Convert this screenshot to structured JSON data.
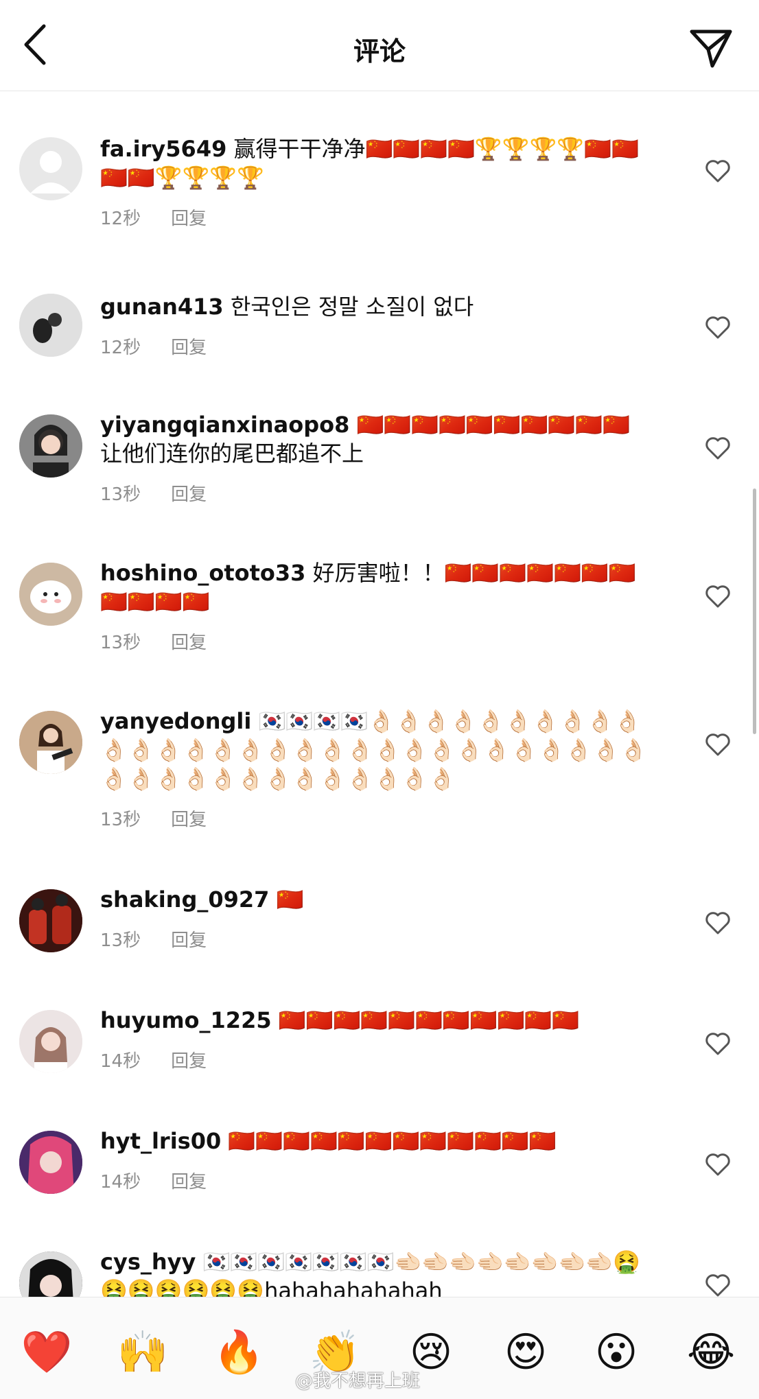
{
  "header": {
    "title": "评论"
  },
  "comments": [
    {
      "user": "fa.iry5649",
      "text": "赢得干干净净🇨🇳🇨🇳🇨🇳🇨🇳🏆🏆🏆🏆🇨🇳🇨🇳🇨🇳🇨🇳🏆🏆🏆🏆",
      "time": "12秒",
      "reply": "回复"
    },
    {
      "user": "gunan413",
      "text": "한국인은 정말 소질이 없다",
      "time": "12秒",
      "reply": "回复"
    },
    {
      "user": "yiyangqianxinaopo8",
      "text": "🇨🇳🇨🇳🇨🇳🇨🇳🇨🇳🇨🇳🇨🇳🇨🇳🇨🇳🇨🇳让他们连你的尾巴都追不上",
      "time": "13秒",
      "reply": "回复"
    },
    {
      "user": "hoshino_ototo33",
      "text": "好厉害啦！！🇨🇳🇨🇳🇨🇳🇨🇳🇨🇳🇨🇳🇨🇳🇨🇳🇨🇳🇨🇳🇨🇳",
      "time": "13秒",
      "reply": "回复"
    },
    {
      "user": "yanyedongli",
      "text": "🇰🇷🇰🇷🇰🇷🇰🇷👌🏻👌🏻👌🏻👌🏻👌🏻👌🏻👌🏻👌🏻👌🏻👌🏻👌🏻👌🏻👌🏻👌🏻👌🏻👌🏻👌🏻👌🏻👌🏻👌🏻👌🏻👌🏻👌🏻👌🏻👌🏻👌🏻👌🏻👌🏻👌🏻👌🏻👌🏻👌🏻👌🏻👌🏻👌🏻👌🏻👌🏻👌🏻👌🏻👌🏻👌🏻👌🏻👌🏻",
      "time": "13秒",
      "reply": "回复"
    },
    {
      "user": "shaking_0927",
      "text": "🇨🇳",
      "time": "13秒",
      "reply": "回复"
    },
    {
      "user": "huyumo_1225",
      "text": "🇨🇳🇨🇳🇨🇳🇨🇳🇨🇳🇨🇳🇨🇳🇨🇳🇨🇳🇨🇳🇨🇳",
      "time": "14秒",
      "reply": "回复"
    },
    {
      "user": "hyt_lris00",
      "text": "🇨🇳🇨🇳🇨🇳🇨🇳🇨🇳🇨🇳🇨🇳🇨🇳🇨🇳🇨🇳🇨🇳🇨🇳",
      "time": "14秒",
      "reply": "回复"
    },
    {
      "user": "cys_hyy",
      "text": "🇰🇷🇰🇷🇰🇷🇰🇷🇰🇷🇰🇷🇰🇷🫲🏻🫲🏻🫲🏻🫲🏻🫲🏻🫲🏻🫲🏻🫲🏻🤮🤮🤮🤮🤮🤮🤮hahahahahahah",
      "time": "",
      "reply": ""
    }
  ],
  "emoji_bar": [
    "❤️",
    "🙌",
    "🔥",
    "👏",
    "😢",
    "😍",
    "😮",
    "😂"
  ],
  "watermark": "@我不想再上班",
  "icons": {
    "back": "chevron-left-icon",
    "send": "paper-plane-icon",
    "like": "heart-outline-icon"
  }
}
